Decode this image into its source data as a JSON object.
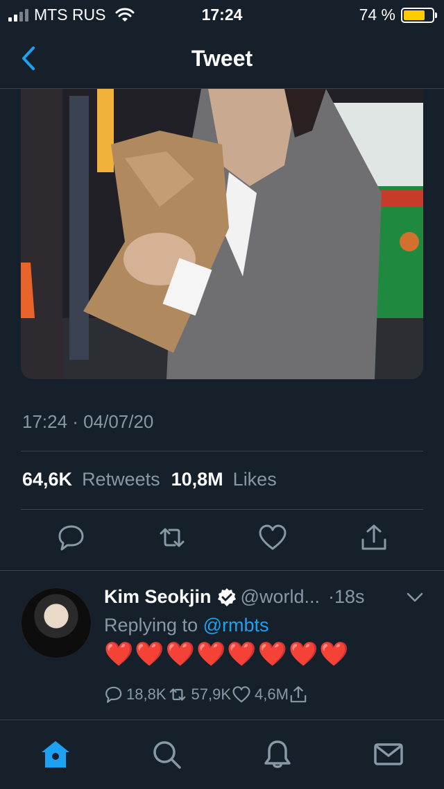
{
  "status_bar": {
    "carrier": "MTS RUS",
    "time": "17:24",
    "battery_text": "74 %",
    "battery_level": 0.74
  },
  "nav": {
    "title": "Tweet"
  },
  "tweet": {
    "timestamp": "17:24 · 04/07/20",
    "retweets_count": "64,6K",
    "retweets_label": "Retweets",
    "likes_count": "10,8M",
    "likes_label": "Likes"
  },
  "reply": {
    "name": "Kim Seokjin",
    "handle": "@world...",
    "time": "·18s",
    "replying_prefix": "Replying to",
    "replying_to": "@rmbts",
    "text": "❤️❤️❤️❤️❤️❤️❤️❤️",
    "reply_count": "18,8K",
    "retweet_count": "57,9K",
    "like_count": "4,6M"
  },
  "colors": {
    "background": "#15202b",
    "accent": "#1da1f2",
    "secondary_text": "#8899a6",
    "divider": "#38444d"
  },
  "icons": {
    "back": "chevron-left-icon",
    "reply": "speech-bubble-icon",
    "retweet": "retweet-icon",
    "like": "heart-icon",
    "share": "share-icon",
    "home": "home-icon",
    "search": "search-icon",
    "notifications": "bell-icon",
    "messages": "mail-icon"
  }
}
